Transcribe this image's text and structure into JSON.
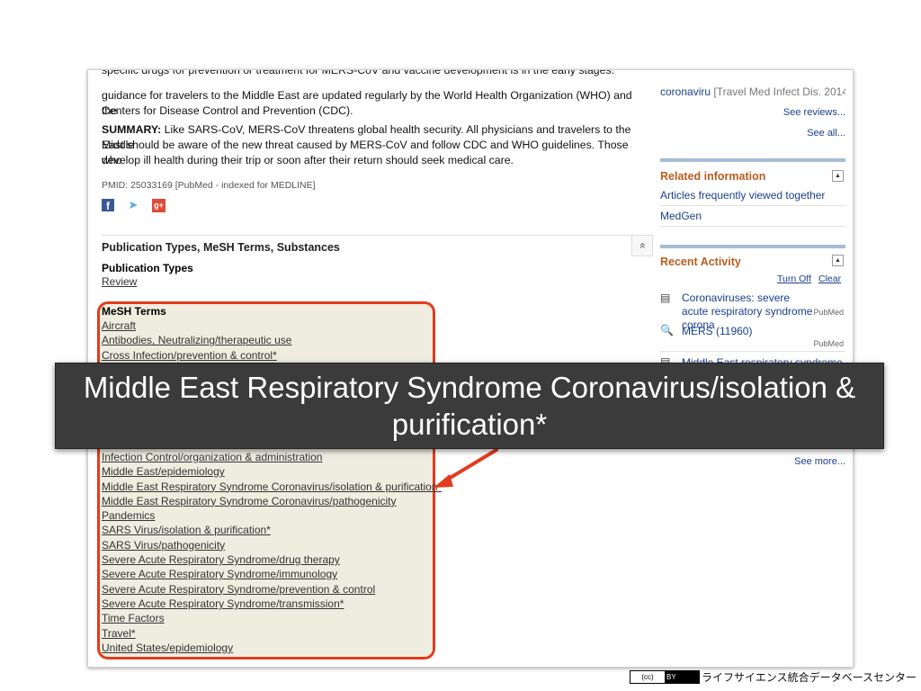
{
  "abstract": {
    "cut_line": "specific drugs for prevention or treatment for MERS-CoV and vaccine development is in the early stages. Advice and",
    "lines": [
      "guidance for travelers to the Middle East are updated regularly by the World Health Organization (WHO) and the",
      "Centers for Disease Control and Prevention (CDC)."
    ],
    "summary_label": "SUMMARY:",
    "summary_lines": [
      " Like SARS-CoV, MERS-CoV threatens global health security. All physicians and travelers to the Middle",
      "East should be aware of the new threat caused by MERS-CoV and follow CDC and WHO guidelines. Those who",
      "develop ill health during their trip or soon after their return should seek medical care."
    ],
    "pmid": "PMID: 25033169 [PubMed - indexed for MEDLINE]"
  },
  "share": {
    "facebook_icon": "f",
    "twitter_icon": "➤",
    "gplus_icon": "g+"
  },
  "section": {
    "title": "Publication Types, MeSH Terms, Substances",
    "collapse_icon": "«",
    "publication_types_heading": "Publication Types",
    "publication_types": [
      "Review"
    ],
    "mesh_heading": "MeSH Terms",
    "mesh_terms_top": [
      "Aircraft",
      "Antibodies, Neutralizing/therapeutic use",
      "Cross Infection/prevention & control*"
    ],
    "mesh_terms_bottom": [
      "Infection Control/organization & administration",
      "Middle East/epidemiology",
      "Middle East Respiratory Syndrome Coronavirus/isolation & purification*",
      "Middle East Respiratory Syndrome Coronavirus/pathogenicity",
      "Pandemics",
      "SARS Virus/isolation & purification*",
      "SARS Virus/pathogenicity",
      "Severe Acute Respiratory Syndrome/drug therapy",
      "Severe Acute Respiratory Syndrome/immunology",
      "Severe Acute Respiratory Syndrome/prevention & control",
      "Severe Acute Respiratory Syndrome/transmission*",
      "Time Factors",
      "Travel*",
      "United States/epidemiology"
    ]
  },
  "sidebar": {
    "review_item": "coronaviru",
    "review_source": " [Travel Med Infect Dis. 2014]",
    "see_reviews": "See reviews...",
    "see_all": "See all...",
    "related_title": "Related information",
    "related_links": [
      "Articles frequently viewed together",
      "MedGen"
    ],
    "recent_title": "Recent Activity",
    "turn_off": "Turn Off",
    "clear": "Clear",
    "recent_items": [
      {
        "text": "Coronaviruses: severe acute respiratory syndrome corona",
        "source": "PubMed"
      },
      {
        "text": "MERS (11960)",
        "source": "PubMed"
      },
      {
        "text": "Middle East respiratory syndrome",
        "source": ""
      }
    ],
    "see_more": "See more...",
    "expand_icon": "▲"
  },
  "callout": {
    "text_line1": "Middle East Respiratory Syndrome Coronavirus/isolation &",
    "text_line2": "purification*",
    "arrow_color": "#e23b1d"
  },
  "footer": {
    "license_cc": "(cc)",
    "license_by": "BY",
    "org_name": "ライフサイエンス統合データベースセンター"
  }
}
